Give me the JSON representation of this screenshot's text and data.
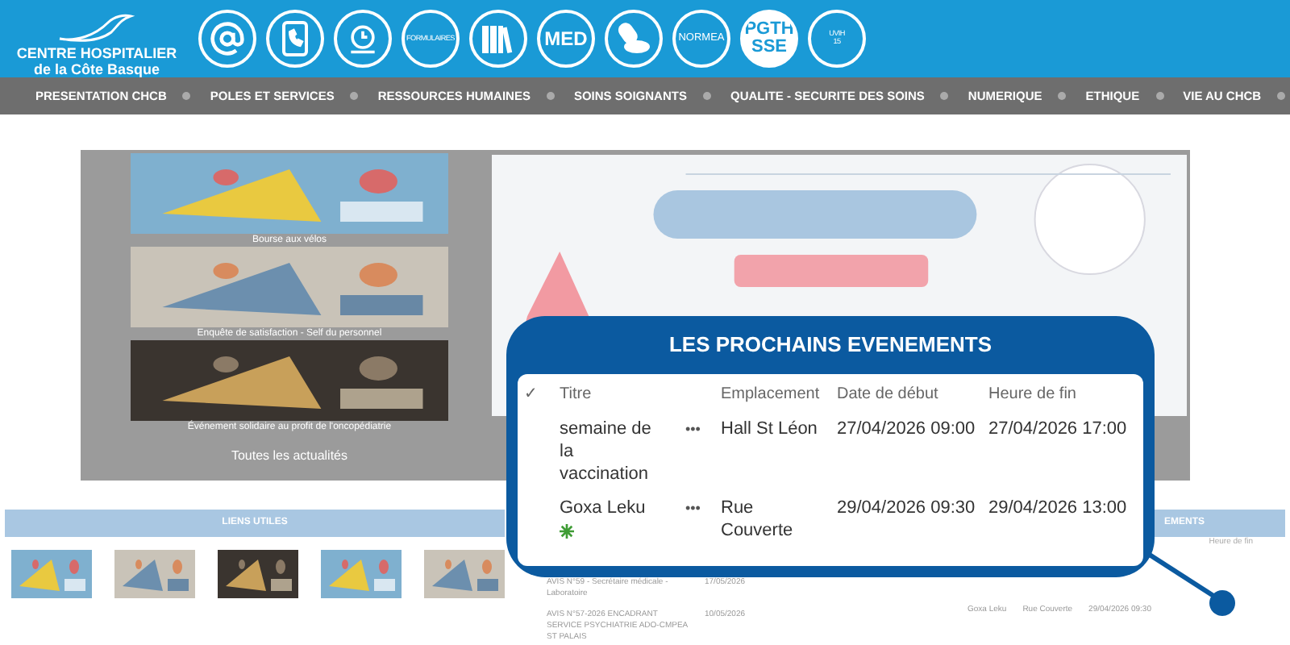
{
  "header": {
    "logo_lines": [
      "CENTRE HOSPITALIER",
      "de la Côte Basque"
    ],
    "shortcuts": [
      {
        "kind": "at"
      },
      {
        "kind": "phone"
      },
      {
        "kind": "clock"
      },
      {
        "kind": "text",
        "label": "FORMULAIRES"
      },
      {
        "kind": "books"
      },
      {
        "kind": "text",
        "label": "MED"
      },
      {
        "kind": "pills"
      },
      {
        "kind": "text",
        "label": "NORMEA"
      },
      {
        "kind": "filled",
        "label": "PGTH SSE"
      },
      {
        "kind": "text",
        "label": "UVIH 15"
      }
    ]
  },
  "nav": [
    "PRESENTATION CHCB",
    "POLES ET SERVICES",
    "RESSOURCES HUMAINES",
    "SOINS SOIGNANTS",
    "QUALITE - SECURITE DES SOINS",
    "NUMERIQUE",
    "ETHIQUE",
    "VIE AU CHCB"
  ],
  "news": {
    "items": [
      {
        "caption": "Bourse aux vélos",
        "kind": "picture"
      },
      {
        "caption": "Enquête de satisfaction - Self du personnel",
        "kind": "picture"
      },
      {
        "caption": "Événement solidaire au profit de l'oncopédiatrie",
        "kind": "picture"
      }
    ],
    "all_link": "Toutes les actualités"
  },
  "links": {
    "title": "LIENS UTILES"
  },
  "notices": [
    {
      "title": "AVIS N°59 - Secrétaire médicale - Laboratoire",
      "date": "17/05/2026"
    },
    {
      "title": "AVIS N°57-2026 ENCADRANT SERVICE PSYCHIATRIE ADO-CMPEA ST PALAIS",
      "date": "10/05/2026"
    }
  ],
  "mini_events": {
    "title": "EMENTS",
    "column": "Heure de fin",
    "row": {
      "title": "Goxa Leku",
      "location": "Rue Couverte",
      "start": "29/04/2026 09:30"
    }
  },
  "callout": {
    "title": "LES PROCHAINS EVENEMENTS",
    "check": "✓",
    "columns": [
      "Titre",
      "Emplacement",
      "Date de début",
      "Heure de fin"
    ],
    "rows": [
      {
        "title": "semaine de la vaccination",
        "new": false,
        "more": "•••",
        "location": "Hall St Léon",
        "start": "27/04/2026 09:00",
        "end": "27/04/2026 17:00"
      },
      {
        "title": "Goxa Leku",
        "new": true,
        "more": "•••",
        "location": "Rue Couverte",
        "start": "29/04/2026 09:30",
        "end": "29/04/2026 13:00"
      }
    ]
  }
}
